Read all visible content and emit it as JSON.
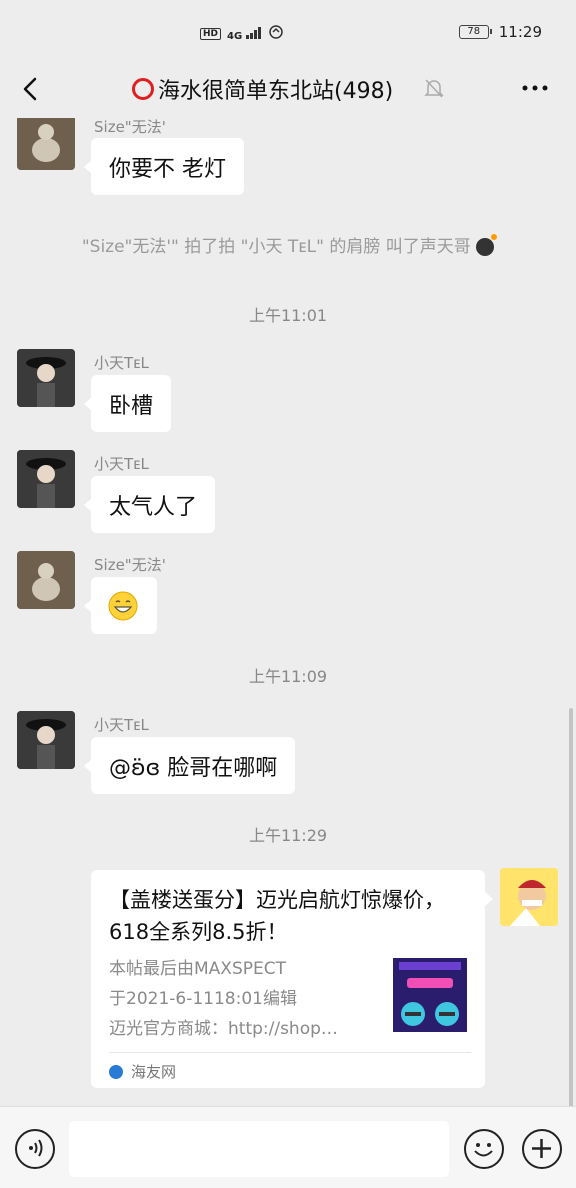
{
  "status_bar": {
    "network_tag": "HD",
    "signal_label": "4G",
    "battery": "78",
    "time": "11:29"
  },
  "header": {
    "title": "海水很简单东北站(498)"
  },
  "messages": {
    "m0": {
      "sender": "Size\"无法'",
      "text": "你要不 老灯"
    },
    "sys": "\"Size\"无法'\" 拍了拍 \"小天 TᴇL\" 的肩膀 叫了声天哥",
    "t1": "上午11:01",
    "m1": {
      "sender": "小天TᴇL",
      "text": "卧槽"
    },
    "m2": {
      "sender": "小天TᴇL",
      "text": "太气人了"
    },
    "m3": {
      "sender": "Size\"无法'",
      "emoji": "grinning-face"
    },
    "t2": "上午11:09",
    "m4": {
      "sender": "小天TᴇL",
      "text": "@ʚ̈ɞ 脸哥在哪啊"
    },
    "t3": "上午11:29"
  },
  "link_card": {
    "title": "【盖楼送蛋分】迈光启航灯惊爆价，618全系列8.5折！",
    "desc_1": "本帖最后由MAXSPECT",
    "desc_2": "于2021-6-1118:01编辑",
    "desc_3": "迈光官方商城：http://shop…",
    "source": "海友网"
  },
  "colors": {
    "background": "#ededed",
    "bubble": "#ffffff",
    "accent_red": "#e02020"
  }
}
